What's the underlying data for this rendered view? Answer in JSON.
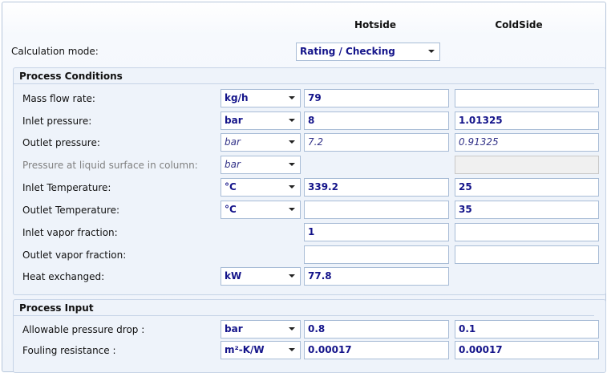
{
  "headers": {
    "hot": "Hotside",
    "cold": "ColdSide"
  },
  "calc_mode": {
    "label": "Calculation mode:",
    "value": "Rating / Checking"
  },
  "process_conditions": {
    "title": "Process Conditions",
    "rows": [
      {
        "label": "Mass flow rate:",
        "unit": "kg/h",
        "hot": "79",
        "cold": ""
      },
      {
        "label": "Inlet pressure:",
        "unit": "bar",
        "hot": "8",
        "cold": "1.01325"
      },
      {
        "label": "Outlet pressure:",
        "unit": "bar",
        "hot": "7.2",
        "cold": "0.91325"
      },
      {
        "label": "Pressure at liquid surface in column:",
        "unit": "bar",
        "hot": "",
        "cold": ""
      },
      {
        "label": "Inlet Temperature:",
        "unit": "°C",
        "hot": "339.2",
        "cold": "25"
      },
      {
        "label": "Outlet Temperature:",
        "unit": "°C",
        "hot": "",
        "cold": "35"
      },
      {
        "label": "Inlet vapor fraction:",
        "unit": "",
        "hot": "1",
        "cold": ""
      },
      {
        "label": "Outlet vapor fraction:",
        "unit": "",
        "hot": "",
        "cold": ""
      },
      {
        "label": "Heat exchanged:",
        "unit": "kW",
        "hot": "77.8",
        "cold": ""
      }
    ]
  },
  "process_input": {
    "title": "Process Input",
    "rows": [
      {
        "label": "Allowable pressure drop :",
        "unit": "bar",
        "hot": "0.8",
        "cold": "0.1"
      },
      {
        "label": "Fouling resistance :",
        "unit": "m²-K/W",
        "hot": "0.00017",
        "cold": "0.00017"
      }
    ]
  }
}
